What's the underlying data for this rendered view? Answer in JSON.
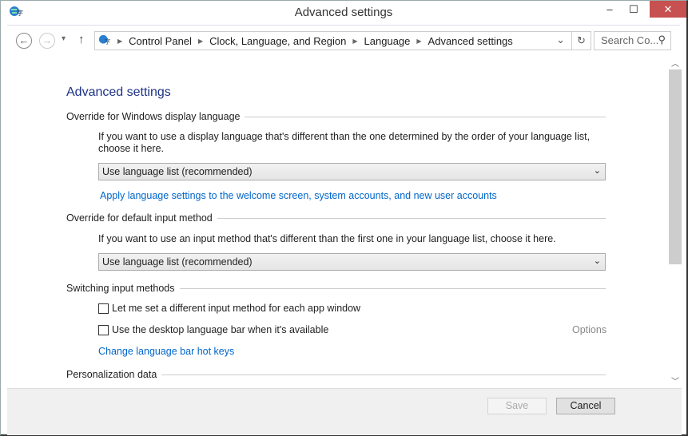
{
  "window": {
    "title": "Advanced settings",
    "minimize": "–",
    "maximize": "☐",
    "close": "✕"
  },
  "nav": {
    "back": "←",
    "forward": "→",
    "recent": "▾",
    "up": "↑",
    "breadcrumb": [
      "Control Panel",
      "Clock, Language, and Region",
      "Language",
      "Advanced settings"
    ],
    "refresh": "↻",
    "dropdown": "⌄",
    "search_placeholder": "Search Co...",
    "search_icon": "⚲"
  },
  "main": {
    "heading": "Advanced settings",
    "display_lang": {
      "label": "Override for Windows display language",
      "desc": "If you want to use a display language that's different than the one determined by the order of your language list, choose it here.",
      "value": "Use language list (recommended)",
      "link": "Apply language settings to the welcome screen, system accounts, and new user accounts"
    },
    "input_method": {
      "label": "Override for default input method",
      "desc": "If you want to use an input method that's different than the first one in your language list, choose it here.",
      "value": "Use language list (recommended)"
    },
    "switching": {
      "label": "Switching input methods",
      "opt1": "Let me set a different input method for each app window",
      "opt2": "Use the desktop language bar when it's available",
      "options": "Options",
      "hotkeys": "Change language bar hot keys",
      "opt1_checked": false,
      "opt2_checked": false
    },
    "personalization": {
      "label": "Personalization data"
    }
  },
  "footer": {
    "save": "Save",
    "cancel": "Cancel"
  },
  "chev": "⌄"
}
